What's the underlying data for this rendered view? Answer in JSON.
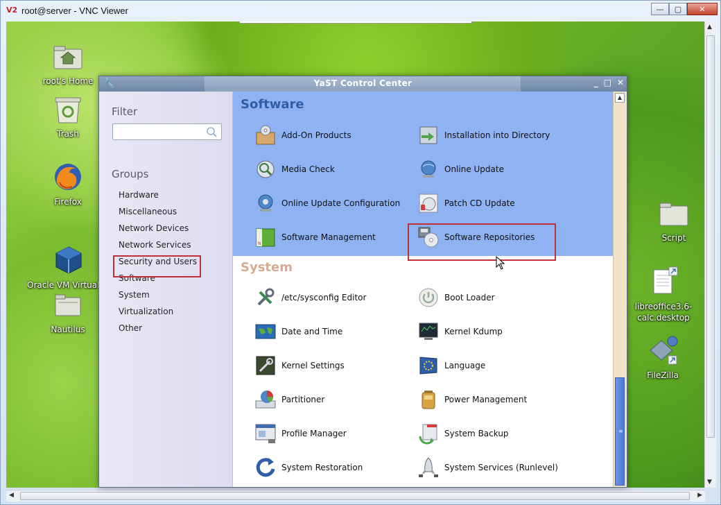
{
  "window": {
    "title": "root@server - VNC Viewer",
    "logo": "V2",
    "buttons": {
      "minimize": "—",
      "maximize": "▢",
      "close": "✕"
    }
  },
  "desktop": {
    "icons": [
      {
        "label": "root's Home",
        "icon": "home-folder-icon"
      },
      {
        "label": "Trash",
        "icon": "trash-icon"
      },
      {
        "label": "Firefox",
        "icon": "firefox-icon"
      },
      {
        "label": "Oracle VM VirtualBox",
        "icon": "virtualbox-icon"
      },
      {
        "label": "Nautilus",
        "icon": "nautilus-icon"
      },
      {
        "label": "Script",
        "icon": "folder-icon"
      },
      {
        "label": "libreoffice3.6-calc.desktop",
        "icon": "document-icon"
      },
      {
        "label": "FileZilla",
        "icon": "filezilla-icon"
      }
    ]
  },
  "yast": {
    "title": "YaST Control Center",
    "controls": {
      "minimize": "_",
      "maximize": "□",
      "close": "✕"
    },
    "filter_heading": "Filter",
    "filter_value": "",
    "groups_heading": "Groups",
    "groups": [
      "Hardware",
      "Miscellaneous",
      "Network Devices",
      "Network Services",
      "Security and Users",
      "Software",
      "System",
      "Virtualization",
      "Other"
    ],
    "selected_group": "Software",
    "software_heading": "Software",
    "software_modules": [
      "Add-On Products",
      "Installation into Directory",
      "Media Check",
      "Online Update",
      "Online Update Configuration",
      "Patch CD Update",
      "Software Management",
      "Software Repositories"
    ],
    "system_heading": "System",
    "system_modules": [
      "/etc/sysconfig Editor",
      "Boot Loader",
      "Date and Time",
      "Kernel Kdump",
      "Kernel Settings",
      "Language",
      "Partitioner",
      "Power Management",
      "Profile Manager",
      "System Backup",
      "System Restoration",
      "System Services (Runlevel)"
    ],
    "highlighted_module": "Software Repositories"
  },
  "colors": {
    "software_section_bg": "#8fb2f2",
    "software_heading": "#2d5ea6",
    "system_heading": "#d8aa92",
    "highlight_box": "#c0303b"
  }
}
